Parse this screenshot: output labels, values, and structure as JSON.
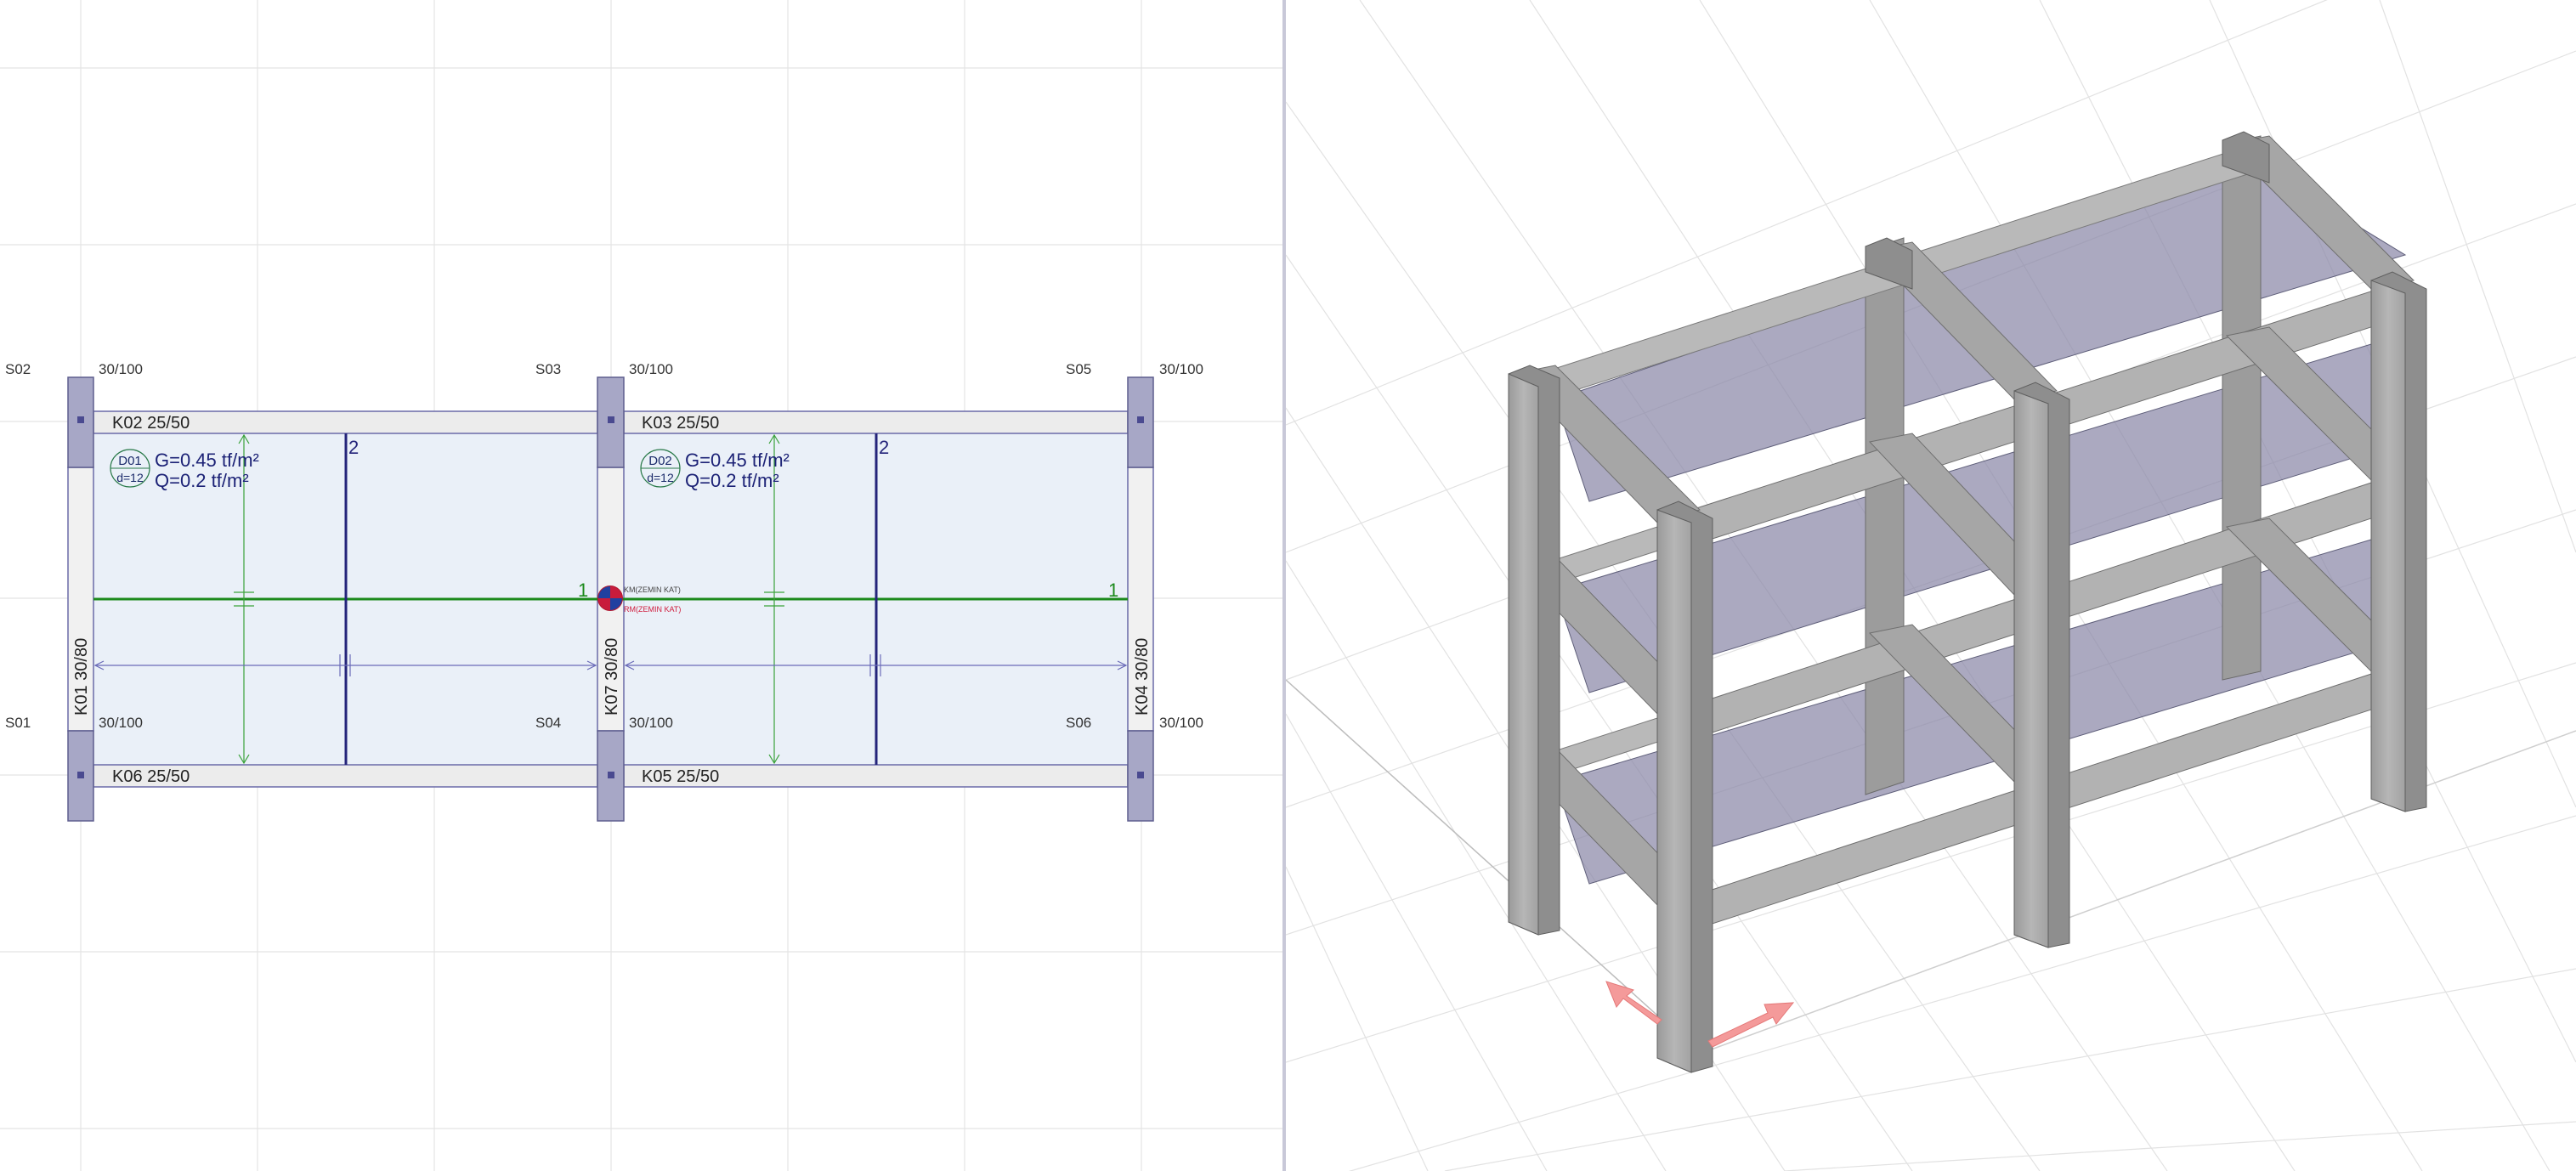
{
  "plan": {
    "supports": [
      "S01",
      "S02",
      "S03",
      "S04",
      "S05",
      "S06"
    ],
    "column_sizes": [
      "30/100",
      "30/100",
      "30/100",
      "30/100",
      "30/100",
      "30/100"
    ],
    "beams": {
      "k01": "K01 30/80",
      "k02": "K02 25/50",
      "k03": "K03 25/50",
      "k04": "K04 30/80",
      "k05": "K05 25/50",
      "k06": "K06 25/50",
      "k07": "K07 30/80"
    },
    "slabs": [
      {
        "name": "D01",
        "thickness": "d=12",
        "g": "G=0.45 tf/m²",
        "q": "Q=0.2 tf/m²"
      },
      {
        "name": "D02",
        "thickness": "d=12",
        "g": "G=0.45 tf/m²",
        "q": "Q=0.2 tf/m²"
      }
    ],
    "axes": {
      "a1": "1",
      "a2": "2"
    },
    "centers": {
      "mass": "KM(ZEMIN KAT)",
      "rigidity": "RM(ZEMIN KAT)"
    }
  },
  "colors": {
    "slab_fill": "#eaf0f8",
    "column_fill": "#a7a7c6",
    "axis_green": "#1c8a1c",
    "axis_blue": "#24247a",
    "beam_outline": "#6a6aa8",
    "concrete": "#a9a9a9",
    "glass_slab": "#8a88a8",
    "ucs_arrow": "#f49a9a"
  },
  "icons": {
    "centroid": "mass-center-icon",
    "ucs": "ucs-axis-icon"
  }
}
